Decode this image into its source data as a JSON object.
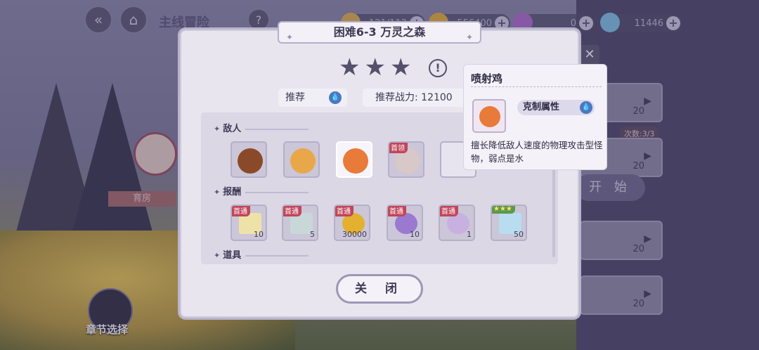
{
  "topbar": {
    "title": "主线冒险",
    "stamina": "121/112",
    "gold": "556400",
    "gem_purple": "0",
    "diamond": "11446"
  },
  "side": {
    "char_label": "育房",
    "chapter_select": "章节选择",
    "times": "次数:3/3",
    "start": "开 始",
    "counts": [
      "20",
      "20",
      "20",
      "20"
    ]
  },
  "modal": {
    "title": "困难6-3 万灵之森",
    "recommend_label": "推荐",
    "power_label": "推荐战力: 12100",
    "sections": {
      "enemies": "敌人",
      "rewards": "报酬",
      "items": "道具"
    },
    "enemy_badge": "首领",
    "rewards": [
      {
        "badge": "首通",
        "qty": "10"
      },
      {
        "badge": "首通",
        "qty": "5"
      },
      {
        "badge": "首通",
        "qty": "30000"
      },
      {
        "badge": "首通",
        "qty": "10"
      },
      {
        "badge": "首通",
        "qty": "1"
      },
      {
        "badge": "★★★",
        "qty": "50"
      }
    ],
    "close": "关 闭"
  },
  "tooltip": {
    "name": "喷射鸡",
    "attr_label": "克制属性",
    "desc": "擅长降低敌人速度的物理攻击型怪物，弱点是水"
  },
  "colors": {
    "accent": "#4b78c0",
    "badge": "#c0465a",
    "panel": "#e8e5ef"
  }
}
